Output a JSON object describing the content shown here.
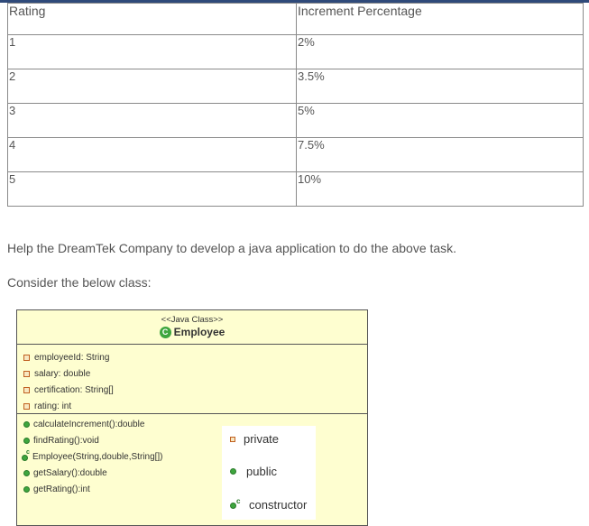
{
  "rating_table": {
    "headers": [
      "Rating",
      "Increment Percentage"
    ],
    "rows": [
      [
        "1",
        "2%"
      ],
      [
        "2",
        "3.5%"
      ],
      [
        "3",
        "5%"
      ],
      [
        "4",
        "7.5%"
      ],
      [
        "5",
        "10%"
      ]
    ]
  },
  "paragraphs": {
    "help": "Help the DreamTek Company to develop a java application to do the above task.",
    "consider": "Consider the below class:"
  },
  "uml": {
    "stereotype": "<<Java Class>>",
    "class_name": "Employee",
    "fields": [
      "employeeId: String",
      "salary: double",
      "certification: String[]",
      "rating: int"
    ],
    "methods": [
      "calculateIncrement():double",
      "findRating():void",
      "Employee(String,double,String[])",
      "getSalary():double",
      "getRating():int"
    ],
    "colors": {
      "background": "#fefed0",
      "public_icon": "#3ea63e",
      "private_icon": "#c06020"
    }
  },
  "legend": {
    "private": "private",
    "public": "public",
    "constructor": "constructor"
  }
}
